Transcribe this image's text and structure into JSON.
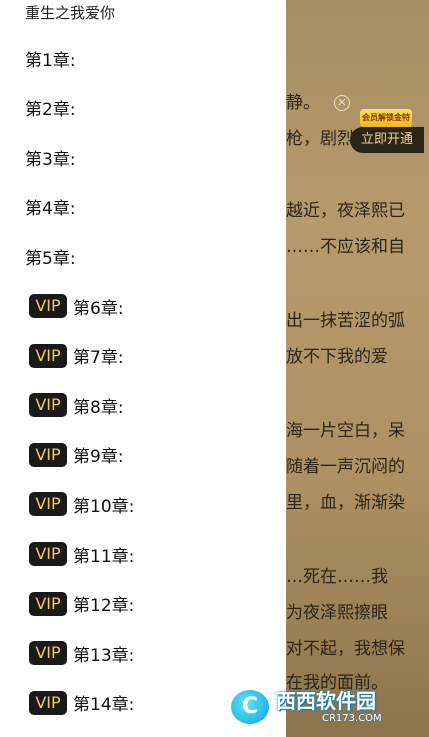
{
  "drawer": {
    "title": "重生之我爱你",
    "chapters": [
      {
        "label": "第1章:",
        "vip": false
      },
      {
        "label": "第2章:",
        "vip": false
      },
      {
        "label": "第3章:",
        "vip": false
      },
      {
        "label": "第4章:",
        "vip": false
      },
      {
        "label": "第5章:",
        "vip": false
      },
      {
        "label": "第6章:",
        "vip": true
      },
      {
        "label": "第7章:",
        "vip": true
      },
      {
        "label": "第8章:",
        "vip": true
      },
      {
        "label": "第9章:",
        "vip": true
      },
      {
        "label": "第10章:",
        "vip": true
      },
      {
        "label": "第11章:",
        "vip": true
      },
      {
        "label": "第12章:",
        "vip": true
      },
      {
        "label": "第13章:",
        "vip": true
      },
      {
        "label": "第14章:",
        "vip": true
      }
    ],
    "vip_badge": "VIP"
  },
  "reader": {
    "lines": [
      "静。",
      "枪，剧烈",
      "越近，夜泽熙已",
      "……不应该和自",
      "出一抹苦涩的弧",
      "放不下我的爱",
      "海一片空白，呆",
      "随着一声沉闷的",
      "里，血，渐渐染",
      "…死在……我",
      "为夜泽熙擦眼",
      "对不起，我想保",
      "在我的面前。"
    ],
    "close_icon": "close-circle-icon",
    "promo_tag": "会员解锁金特",
    "promo_button": "立即开通"
  },
  "watermark": {
    "logo_letter": "C",
    "name": "西西软件园",
    "url": "CR173.COM"
  },
  "colors": {
    "vip_badge_bg": "#1a1a1a",
    "vip_badge_text": "#f2c95c",
    "promo_button_bg": "#2b2418",
    "promo_button_text": "#f3d58b"
  }
}
